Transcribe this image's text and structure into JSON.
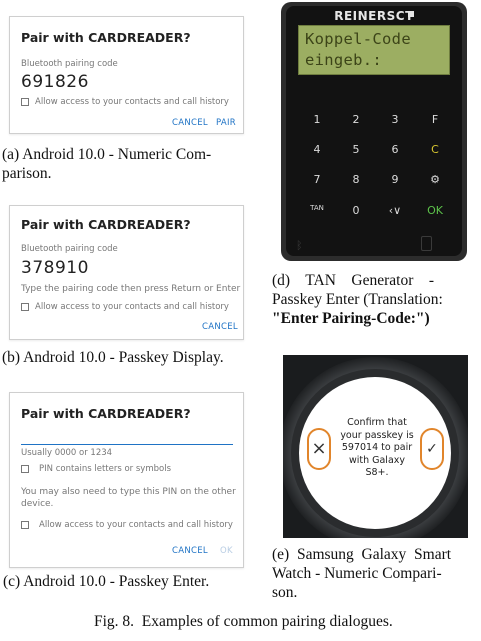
{
  "panel_a": {
    "title": "Pair with CARDREADER?",
    "code_label": "Bluetooth pairing code",
    "code": "691826",
    "checkbox_label": "Allow access to your contacts and call history",
    "cancel": "CANCEL",
    "pair": "PAIR",
    "caption_line1": "(a) Android 10.0 - Numeric Com-",
    "caption_line2": "parison."
  },
  "panel_b": {
    "title": "Pair with CARDREADER?",
    "code_label": "Bluetooth pairing code",
    "code": "378910",
    "instruction": "Type the pairing code then press Return or Enter",
    "checkbox_label": "Allow access to your contacts and call history",
    "cancel": "CANCEL",
    "caption": "(b) Android 10.0 - Passkey Display."
  },
  "panel_c": {
    "title": "Pair with CARDREADER?",
    "hint": "Usually 0000 or 1234",
    "pin_letters": "PIN contains letters or symbols",
    "note_line1": "You may also need to type this PIN on the other",
    "note_line2": "device.",
    "checkbox_label": "Allow access to your contacts and call history",
    "cancel": "CANCEL",
    "ok": "OK",
    "caption": "(c) Android 10.0 - Passkey Enter."
  },
  "panel_d": {
    "brand": "REINERSCT",
    "display_line1": "Koppel-Code",
    "display_line2": "eingeb.:",
    "keys": [
      "1",
      "2",
      "3",
      "F",
      "4",
      "5",
      "6",
      "C",
      "7",
      "8",
      "9",
      "⚙",
      "TAN",
      "0",
      "‹∨",
      "OK"
    ],
    "caption_line1": "(d)    TAN    Generator    -",
    "caption_line2": "Passkey Enter (Translation:",
    "caption_line3": "\"Enter Pairing-Code:\")"
  },
  "panel_e": {
    "screen_lines": [
      "Confirm that",
      "your passkey is",
      "597014 to pair",
      "with Galaxy",
      "S8+."
    ],
    "cancel_icon": "×",
    "confirm_icon": "✓",
    "caption_line1": "(e)  Samsung  Galaxy  Smart",
    "caption_line2": "Watch - Numeric Compari-",
    "caption_line3": "son."
  },
  "figure_caption": "Fig. 8.  Examples of common pairing dialogues.",
  "colors": {
    "android_accent": "#1f73c5",
    "lcd_background": "#9cae62",
    "tan_ok": "#5cc14a",
    "tan_clear": "#d7c630",
    "watch_highlight": "#e1852b"
  }
}
